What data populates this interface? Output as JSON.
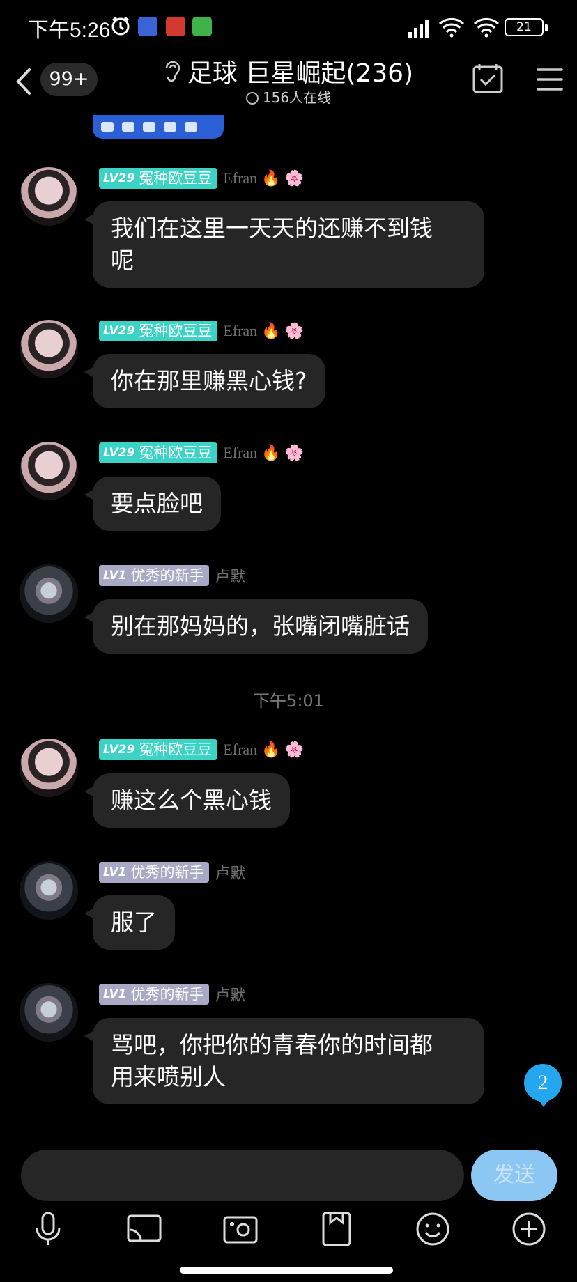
{
  "status_bar": {
    "time": "下午5:26",
    "battery": "21"
  },
  "header": {
    "back_label": "",
    "unread_badge": "99+",
    "group_title": "足球 巨星崛起(236)",
    "online_count": "156人在线"
  },
  "messages": [
    {
      "avatar": "avatar-a",
      "level": "LV29",
      "title": "冤种欧豆豆",
      "nick": "Efran",
      "text_lines": [
        "我们在这里一天天的还赚不到钱",
        "呢"
      ]
    },
    {
      "avatar": "avatar-a",
      "level": "LV29",
      "title": "冤种欧豆豆",
      "nick": "Efran",
      "text_lines": [
        "你在那里赚黑心钱?"
      ]
    },
    {
      "avatar": "avatar-a",
      "level": "LV29",
      "title": "冤种欧豆豆",
      "nick": "Efran",
      "text_lines": [
        "要点脸吧"
      ]
    },
    {
      "avatar": "avatar-b",
      "level": "LV1",
      "title": "优秀的新手",
      "nick": "卢默",
      "text_lines": [
        "别在那妈妈的，张嘴闭嘴脏话"
      ]
    },
    {
      "avatar": "avatar-a",
      "level": "LV29",
      "title": "冤种欧豆豆",
      "nick": "Efran",
      "text_lines": [
        "赚这么个黑心钱"
      ]
    },
    {
      "avatar": "avatar-b",
      "level": "LV1",
      "title": "优秀的新手",
      "nick": "卢默",
      "text_lines": [
        "服了"
      ]
    },
    {
      "avatar": "avatar-b",
      "level": "LV1",
      "title": "优秀的新手",
      "nick": "卢默",
      "text_lines": [
        "骂吧，你把你的青春你的时间都",
        "用来喷别人"
      ]
    }
  ],
  "timestamp": "下午5:01",
  "unread_new": "2",
  "input": {
    "placeholder": "",
    "send_label": "发送"
  },
  "toolbar_icons": [
    "microphone-icon",
    "cast-icon",
    "camera-icon",
    "file-icon",
    "emoji-icon",
    "plus-icon"
  ],
  "colors": {
    "background": "#000000",
    "bubble": "#262626",
    "lv29_tag": "#3ad3c6",
    "lv1_tag": "#a8a9c4",
    "send_button": "#8cc6f2",
    "unread_badge": "#25a7f0"
  }
}
